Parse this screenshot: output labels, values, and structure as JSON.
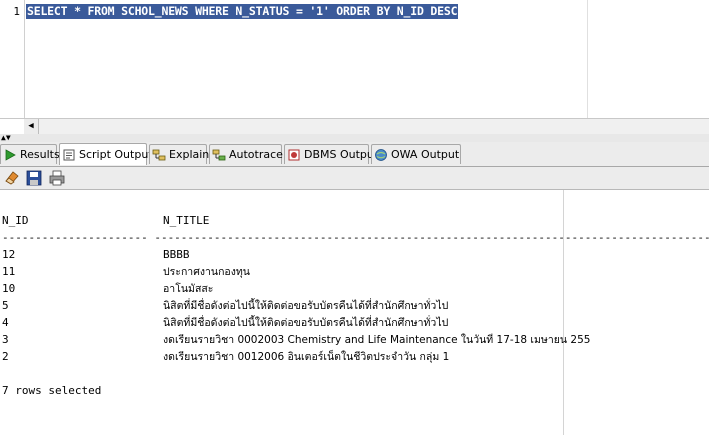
{
  "editor": {
    "line_number": "1",
    "sql": "SELECT * FROM SCHOL_NEWS WHERE N_STATUS = '1' ORDER BY N_ID DESC"
  },
  "tabs": [
    {
      "label": "Results",
      "icon": "results-icon"
    },
    {
      "label": "Script Output",
      "icon": "script-output-icon"
    },
    {
      "label": "Explain",
      "icon": "explain-icon"
    },
    {
      "label": "Autotrace",
      "icon": "autotrace-icon"
    },
    {
      "label": "DBMS Output",
      "icon": "dbms-output-icon"
    },
    {
      "label": "OWA Output",
      "icon": "owa-output-icon"
    }
  ],
  "toolbar": {
    "buttons": [
      "eraser-icon",
      "save-icon",
      "print-icon"
    ]
  },
  "output": {
    "headers": [
      "N_ID",
      "N_TITLE"
    ],
    "separator": "---------------------- -------------------------------------------------------------------------------------------------",
    "rows": [
      {
        "id": "12",
        "title": "BBBB"
      },
      {
        "id": "11",
        "title": "ประกาศงานกองทุน"
      },
      {
        "id": "10",
        "title": "อาโนมัสสะ"
      },
      {
        "id": "5",
        "title": "นิสิตที่มีชื่อดังต่อไปนี้ให้ติดต่อขอรับบัตรคืนได้ที่สำนักศึกษาทั่วไป"
      },
      {
        "id": "4",
        "title": "นิสิตที่มีชื่อดังต่อไปนี้ให้ติดต่อขอรับบัตรคืนได้ที่สำนักศึกษาทั่วไป"
      },
      {
        "id": "3",
        "title": "งดเรียนรายวิชา 0002003 Chemistry and Life Maintenance ในวันที่ 17-18 เมษายน 255"
      },
      {
        "id": "2",
        "title": "งดเรียนรายวิชา 0012006 อินเตอร์เน็ตในชีวิตประจำวัน กลุ่ม 1"
      }
    ],
    "footer": "7 rows selected"
  }
}
